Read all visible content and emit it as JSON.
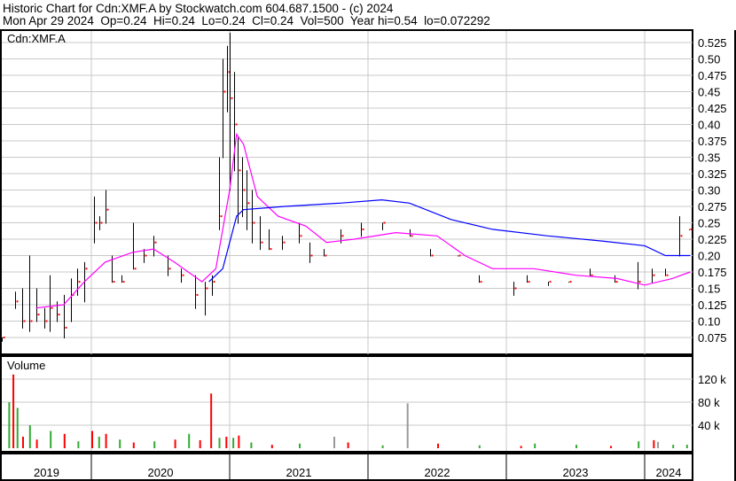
{
  "header": {
    "line1": "Historic Chart for Cdn:XMF.A by Stockwatch.com 604.687.1500 - (c) 2024",
    "line2": "Mon Apr 29 2024  Op=0.24  Hi=0.24  Lo=0.24  Cl=0.24  Vol=500  Year hi=0.54  lo=0.072292"
  },
  "chart_data": {
    "type": "candlestick",
    "symbol_label": "Cdn:XMF.A",
    "volume_label": "Volume",
    "price_ticks": [
      "0.525",
      "0.50",
      "0.475",
      "0.45",
      "0.425",
      "0.40",
      "0.375",
      "0.35",
      "0.325",
      "0.30",
      "0.275",
      "0.25",
      "0.225",
      "0.20",
      "0.175",
      "0.15",
      "0.125",
      "0.10",
      "0.075"
    ],
    "volume_ticks": [
      "120 k",
      "80 k",
      "40 k"
    ],
    "years": [
      "2019",
      "2020",
      "2021",
      "2022",
      "2023",
      "2024"
    ],
    "colors": {
      "ma_short": "#ff00ff",
      "ma_long": "#0000ff",
      "up": "#33aa33",
      "down": "#ff0000",
      "flat": "#999999",
      "close_tick": "#ff0000"
    },
    "bars": [
      [
        2019.35,
        0.07,
        0.075,
        0.075
      ],
      [
        2019.45,
        0.12,
        0.145,
        0.13
      ],
      [
        2019.5,
        0.09,
        0.15,
        0.1
      ],
      [
        2019.55,
        0.085,
        0.2,
        0.1
      ],
      [
        2019.6,
        0.1,
        0.15,
        0.11
      ],
      [
        2019.66,
        0.09,
        0.12,
        0.1
      ],
      [
        2019.7,
        0.085,
        0.17,
        0.12
      ],
      [
        2019.75,
        0.1,
        0.13,
        0.11
      ],
      [
        2019.8,
        0.075,
        0.14,
        0.09
      ],
      [
        2019.85,
        0.1,
        0.165,
        0.14
      ],
      [
        2019.9,
        0.14,
        0.18,
        0.16
      ],
      [
        2019.95,
        0.13,
        0.19,
        0.18
      ],
      [
        2020.02,
        0.22,
        0.29,
        0.25
      ],
      [
        2020.06,
        0.24,
        0.26,
        0.25
      ],
      [
        2020.1,
        0.25,
        0.3,
        0.27
      ],
      [
        2020.15,
        0.16,
        0.2,
        0.16
      ],
      [
        2020.22,
        0.16,
        0.17,
        0.16
      ],
      [
        2020.3,
        0.18,
        0.25,
        0.18
      ],
      [
        2020.38,
        0.19,
        0.21,
        0.2
      ],
      [
        2020.45,
        0.2,
        0.23,
        0.22
      ],
      [
        2020.55,
        0.17,
        0.2,
        0.18
      ],
      [
        2020.65,
        0.16,
        0.18,
        0.17
      ],
      [
        2020.75,
        0.12,
        0.17,
        0.14
      ],
      [
        2020.82,
        0.11,
        0.16,
        0.15
      ],
      [
        2020.87,
        0.14,
        0.17,
        0.16
      ],
      [
        2020.92,
        0.24,
        0.35,
        0.26
      ],
      [
        2020.95,
        0.35,
        0.5,
        0.45
      ],
      [
        2020.98,
        0.42,
        0.52,
        0.48
      ],
      [
        2021.0,
        0.3,
        0.54,
        0.44
      ],
      [
        2021.03,
        0.33,
        0.48,
        0.4
      ],
      [
        2021.06,
        0.25,
        0.38,
        0.33
      ],
      [
        2021.09,
        0.26,
        0.35,
        0.3
      ],
      [
        2021.12,
        0.24,
        0.33,
        0.28
      ],
      [
        2021.16,
        0.22,
        0.3,
        0.25
      ],
      [
        2021.22,
        0.21,
        0.26,
        0.22
      ],
      [
        2021.28,
        0.21,
        0.24,
        0.21
      ],
      [
        2021.38,
        0.21,
        0.23,
        0.22
      ],
      [
        2021.5,
        0.22,
        0.25,
        0.23
      ],
      [
        2021.58,
        0.19,
        0.22,
        0.2
      ],
      [
        2021.68,
        0.2,
        0.21,
        0.2
      ],
      [
        2021.8,
        0.22,
        0.24,
        0.23
      ],
      [
        2021.95,
        0.23,
        0.25,
        0.24
      ],
      [
        2022.1,
        0.24,
        0.25,
        0.25
      ],
      [
        2022.3,
        0.23,
        0.24,
        0.23
      ],
      [
        2022.45,
        0.2,
        0.21,
        0.2
      ],
      [
        2022.65,
        0.2,
        0.2,
        0.2
      ],
      [
        2022.8,
        0.16,
        0.17,
        0.16
      ],
      [
        2023.05,
        0.14,
        0.16,
        0.15
      ],
      [
        2023.15,
        0.16,
        0.17,
        0.16
      ],
      [
        2023.3,
        0.155,
        0.16,
        0.16
      ],
      [
        2023.45,
        0.16,
        0.16,
        0.16
      ],
      [
        2023.6,
        0.17,
        0.18,
        0.17
      ],
      [
        2023.78,
        0.16,
        0.17,
        0.16
      ],
      [
        2023.95,
        0.15,
        0.19,
        0.16
      ],
      [
        2024.05,
        0.16,
        0.18,
        0.17
      ],
      [
        2024.15,
        0.17,
        0.18,
        0.17
      ],
      [
        2024.25,
        0.2,
        0.26,
        0.23
      ],
      [
        2024.32,
        0.24,
        0.24,
        0.24
      ]
    ],
    "ma_short": [
      [
        2019.6,
        0.12
      ],
      [
        2019.8,
        0.125
      ],
      [
        2019.95,
        0.16
      ],
      [
        2020.1,
        0.19
      ],
      [
        2020.3,
        0.205
      ],
      [
        2020.45,
        0.21
      ],
      [
        2020.6,
        0.19
      ],
      [
        2020.8,
        0.16
      ],
      [
        2020.9,
        0.18
      ],
      [
        2021.0,
        0.3
      ],
      [
        2021.05,
        0.385
      ],
      [
        2021.1,
        0.37
      ],
      [
        2021.2,
        0.29
      ],
      [
        2021.35,
        0.26
      ],
      [
        2021.55,
        0.245
      ],
      [
        2021.7,
        0.22
      ],
      [
        2021.9,
        0.225
      ],
      [
        2022.2,
        0.235
      ],
      [
        2022.5,
        0.23
      ],
      [
        2022.7,
        0.2
      ],
      [
        2022.9,
        0.18
      ],
      [
        2023.2,
        0.18
      ],
      [
        2023.5,
        0.17
      ],
      [
        2023.8,
        0.165
      ],
      [
        2024.0,
        0.155
      ],
      [
        2024.2,
        0.165
      ],
      [
        2024.33,
        0.175
      ]
    ],
    "ma_long": [
      [
        2020.85,
        0.16
      ],
      [
        2020.95,
        0.18
      ],
      [
        2021.0,
        0.22
      ],
      [
        2021.05,
        0.26
      ],
      [
        2021.1,
        0.27
      ],
      [
        2021.4,
        0.275
      ],
      [
        2021.8,
        0.28
      ],
      [
        2022.1,
        0.285
      ],
      [
        2022.3,
        0.28
      ],
      [
        2022.6,
        0.255
      ],
      [
        2022.9,
        0.24
      ],
      [
        2023.3,
        0.23
      ],
      [
        2023.7,
        0.222
      ],
      [
        2024.0,
        0.215
      ],
      [
        2024.15,
        0.2
      ],
      [
        2024.33,
        0.2
      ]
    ],
    "volume": [
      [
        2019.4,
        80,
        "up"
      ],
      [
        2019.43,
        128,
        "down"
      ],
      [
        2019.46,
        70,
        "up"
      ],
      [
        2019.5,
        20,
        "down"
      ],
      [
        2019.55,
        40,
        "up"
      ],
      [
        2019.6,
        15,
        "down"
      ],
      [
        2019.7,
        30,
        "up"
      ],
      [
        2019.8,
        25,
        "down"
      ],
      [
        2019.9,
        12,
        "up"
      ],
      [
        2020.0,
        30,
        "down"
      ],
      [
        2020.05,
        20,
        "up"
      ],
      [
        2020.1,
        25,
        "down"
      ],
      [
        2020.2,
        15,
        "up"
      ],
      [
        2020.3,
        10,
        "down"
      ],
      [
        2020.45,
        12,
        "up"
      ],
      [
        2020.6,
        15,
        "down"
      ],
      [
        2020.7,
        25,
        "up"
      ],
      [
        2020.78,
        14,
        "down"
      ],
      [
        2020.86,
        95,
        "down"
      ],
      [
        2020.92,
        18,
        "up"
      ],
      [
        2020.97,
        20,
        "down"
      ],
      [
        2021.02,
        18,
        "up"
      ],
      [
        2021.06,
        22,
        "down"
      ],
      [
        2021.15,
        10,
        "up"
      ],
      [
        2021.3,
        6,
        "down"
      ],
      [
        2021.5,
        8,
        "up"
      ],
      [
        2021.75,
        20,
        "flat"
      ],
      [
        2021.85,
        10,
        "down"
      ],
      [
        2022.1,
        5,
        "up"
      ],
      [
        2022.28,
        78,
        "flat"
      ],
      [
        2022.5,
        8,
        "down"
      ],
      [
        2022.8,
        5,
        "up"
      ],
      [
        2023.1,
        4,
        "down"
      ],
      [
        2023.2,
        8,
        "up"
      ],
      [
        2023.5,
        6,
        "up"
      ],
      [
        2023.75,
        4,
        "down"
      ],
      [
        2023.95,
        12,
        "up"
      ],
      [
        2024.06,
        14,
        "down"
      ],
      [
        2024.09,
        11,
        "flat"
      ],
      [
        2024.2,
        6,
        "up"
      ],
      [
        2024.3,
        6,
        "up"
      ]
    ]
  }
}
